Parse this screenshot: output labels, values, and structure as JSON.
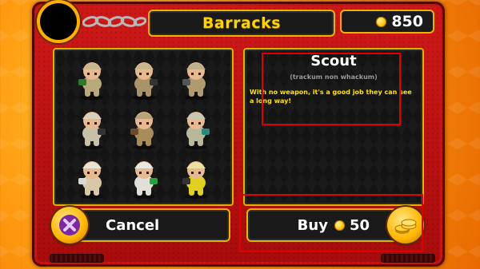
{
  "header": {
    "title": "Barracks",
    "gold_amount": "850"
  },
  "units": [
    {
      "icon": "soldier-binoculars-icon"
    },
    {
      "icon": "soldier-rifle-icon"
    },
    {
      "icon": "soldier-gunner-icon"
    },
    {
      "icon": "soldier-medic-icon"
    },
    {
      "icon": "soldier-officer-icon"
    },
    {
      "icon": "soldier-radio-icon"
    },
    {
      "icon": "soldier-scout-icon"
    },
    {
      "icon": "soldier-engineer-icon"
    },
    {
      "icon": "soldier-demolition-icon"
    }
  ],
  "detail": {
    "name": "Scout",
    "latin": "(trackum non whackum)",
    "description": "With no weapon, it's a good job they can see a long way!"
  },
  "buttons": {
    "cancel_label": "Cancel",
    "buy_label": "Buy",
    "buy_cost": "50"
  },
  "colors": {
    "frame_red": "#c81414",
    "accent_gold": "#f0b000",
    "title_yellow": "#ffd200",
    "desc_yellow": "#ffe000",
    "highlight_red": "#e00000"
  }
}
